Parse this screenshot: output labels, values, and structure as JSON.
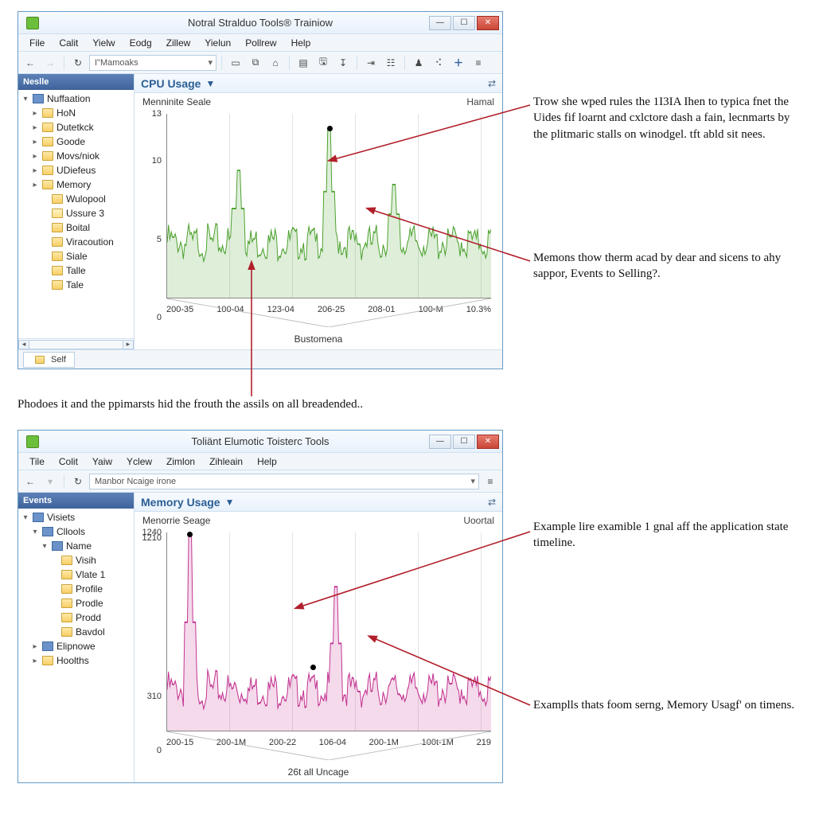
{
  "win1": {
    "title": "Notral Stralduo Tools® Trainiow",
    "menus": [
      "File",
      "Calit",
      "Yielw",
      "Eodg",
      "Zillew",
      "Yielun",
      "Pollrew",
      "Help"
    ],
    "address": "I\"Mamoaks",
    "sidebar_header": "Neslle",
    "tree": [
      {
        "tw": "▾",
        "icon": "box",
        "label": "Nuffaation",
        "depth": 0
      },
      {
        "tw": "▸",
        "icon": "folder",
        "label": "HoN",
        "depth": 1
      },
      {
        "tw": "▸",
        "icon": "folder",
        "label": "Dutetkck",
        "depth": 1
      },
      {
        "tw": "▸",
        "icon": "folder",
        "label": "Goode",
        "depth": 1
      },
      {
        "tw": "▸",
        "icon": "folder",
        "label": "Movs/niok",
        "depth": 1
      },
      {
        "tw": "▸",
        "icon": "folder",
        "label": "UDiefeus",
        "depth": 1
      },
      {
        "tw": "▸",
        "icon": "folder",
        "label": "Memory",
        "depth": 1
      },
      {
        "tw": " ",
        "icon": "folder",
        "label": "Wulopool",
        "depth": 2
      },
      {
        "tw": " ",
        "icon": "folder-open",
        "label": "Ussure 3",
        "depth": 2
      },
      {
        "tw": " ",
        "icon": "folder",
        "label": "Boital",
        "depth": 2
      },
      {
        "tw": " ",
        "icon": "folder",
        "label": "Viracoution",
        "depth": 2
      },
      {
        "tw": " ",
        "icon": "folder",
        "label": "Siale",
        "depth": 2
      },
      {
        "tw": " ",
        "icon": "folder",
        "label": "Talle",
        "depth": 2
      },
      {
        "tw": " ",
        "icon": "folder",
        "label": "Tale",
        "depth": 2
      }
    ],
    "tab_label": "Self",
    "panel_title": "CPU Usage",
    "sub_left": "Menninite Seale",
    "sub_right": "Hamal",
    "axis_caption": "Bustomena"
  },
  "win2": {
    "title": "Toliänt Elumotic Toisterc Tools",
    "menus": [
      "Tile",
      "Colit",
      "Yaiw",
      "Yclew",
      "Zimlon",
      "Zihleain",
      "Help"
    ],
    "address": "Manbor Ncaige irone",
    "sidebar_header": "Events",
    "tree": [
      {
        "tw": "▾",
        "icon": "box",
        "label": "Visiets",
        "depth": 0
      },
      {
        "tw": "▾",
        "icon": "box",
        "label": "Cllools",
        "depth": 1
      },
      {
        "tw": "▾",
        "icon": "box",
        "label": "Name",
        "depth": 2
      },
      {
        "tw": " ",
        "icon": "folder",
        "label": "Visih",
        "depth": 3
      },
      {
        "tw": " ",
        "icon": "folder",
        "label": "Vlate 1",
        "depth": 3
      },
      {
        "tw": " ",
        "icon": "folder",
        "label": "Profile",
        "depth": 3
      },
      {
        "tw": " ",
        "icon": "folder",
        "label": "Prodle",
        "depth": 3
      },
      {
        "tw": " ",
        "icon": "folder",
        "label": "Prodd",
        "depth": 3
      },
      {
        "tw": " ",
        "icon": "folder",
        "label": "Bavdol",
        "depth": 3
      },
      {
        "tw": "▸",
        "icon": "box",
        "label": "Elipnowe",
        "depth": 1
      },
      {
        "tw": "▸",
        "icon": "folder",
        "label": "Hoolths",
        "depth": 1
      }
    ],
    "panel_title": "Memory Usage",
    "sub_left": "Menorrie Seage",
    "sub_right": "Uoortal",
    "axis_caption": "26t all Uncage"
  },
  "annotations": {
    "a1": "Trow she wped rules the 1I3IA Ihen to typica fnet the Uides fif loarnt and cxlctore dash a fain, lecnmarts by the plitmaric stalls on winodgel. tft abld sit nees.",
    "a2": "Memons thow therm acad by dear and sicens to ahy sappor, Events to Selling?.",
    "mid": "Phodoes it and the ppimarsts hid the frouth the assils on all breadended..",
    "a3": "Example lire examible 1 gnal aff the application state timeline.",
    "a4": "Examplls thats foom serng, Memory Usagf' on timens."
  },
  "chart_data": [
    {
      "type": "line",
      "title": "CPU Usage",
      "subtitle": "Menninite Seale",
      "ylabel": "",
      "xlabel": "Bustomena",
      "ylim": [
        0,
        13
      ],
      "yticks": [
        0,
        5,
        10,
        13
      ],
      "xticks": [
        "200-35",
        "100-04",
        "123-04",
        "206-25",
        "208-01",
        "100-M",
        "10.3%"
      ],
      "series": [
        {
          "name": "cpu",
          "color": "#4aa02c",
          "baseline": 4.5,
          "noise": 2.0,
          "spikes": [
            {
              "x": 0.5,
              "y": 12
            },
            {
              "x": 0.22,
              "y": 9
            },
            {
              "x": 0.7,
              "y": 8
            }
          ]
        }
      ],
      "markers": [
        {
          "x": 0.5,
          "y": 12
        }
      ]
    },
    {
      "type": "line",
      "title": "Memory Usage",
      "subtitle": "Menorrie Seage",
      "ylabel": "",
      "xlabel": "26t all Uncage",
      "ylim": [
        0,
        1240
      ],
      "yticks": [
        0,
        310,
        1210,
        1240
      ],
      "xticks": [
        "200-15",
        "200-1M",
        "200-22",
        "106-04",
        "200-1М",
        "100t-1М",
        "219"
      ],
      "series": [
        {
          "name": "mem",
          "color": "#c2308f",
          "baseline": 310,
          "noise": 180,
          "spikes": [
            {
              "x": 0.07,
              "y": 1230
            },
            {
              "x": 0.52,
              "y": 900
            }
          ]
        }
      ],
      "markers": [
        {
          "x": 0.07,
          "y": 1230
        },
        {
          "x": 0.45,
          "y": 400
        }
      ]
    }
  ],
  "colors": {
    "accent": "#2b5e95",
    "arrow": "#b11f2a",
    "cpu": "#4aa02c",
    "mem": "#c2308f"
  }
}
